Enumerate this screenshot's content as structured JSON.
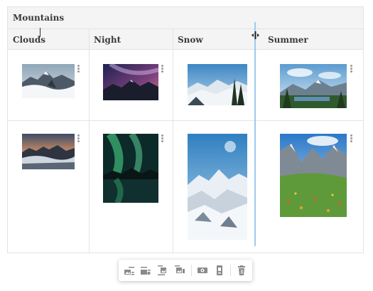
{
  "table": {
    "title": "Mountains",
    "columns": [
      {
        "label": "Clouds"
      },
      {
        "label": "Night"
      },
      {
        "label": "Snow"
      },
      {
        "label": "Summer"
      }
    ],
    "rows": [
      {
        "images": [
          {
            "icon": "cloudy-mountain-photo"
          },
          {
            "icon": "milky-way-mountain-photo"
          },
          {
            "icon": "snowy-valley-photo"
          },
          {
            "icon": "summer-lake-photo"
          }
        ]
      },
      {
        "images": [
          {
            "icon": "sunset-cloud-sea-photo"
          },
          {
            "icon": "aurora-lake-photo"
          },
          {
            "icon": "snow-peaks-photo"
          },
          {
            "icon": "alpine-meadow-photo"
          }
        ]
      }
    ]
  },
  "toolbar": {
    "buttons": [
      {
        "icon": "image-inline-left-icon"
      },
      {
        "icon": "image-inline-right-icon"
      },
      {
        "icon": "image-block-left-icon"
      },
      {
        "icon": "image-block-right-icon"
      },
      {
        "icon": "resize-original-icon"
      },
      {
        "icon": "replace-image-icon"
      },
      {
        "icon": "trash-icon"
      }
    ]
  },
  "colors": {
    "header_bg": "#f4f4f4",
    "border": "#e3e3e3",
    "resize_highlight": "#9ccaf0",
    "icon_gray": "#8a8a8a"
  }
}
